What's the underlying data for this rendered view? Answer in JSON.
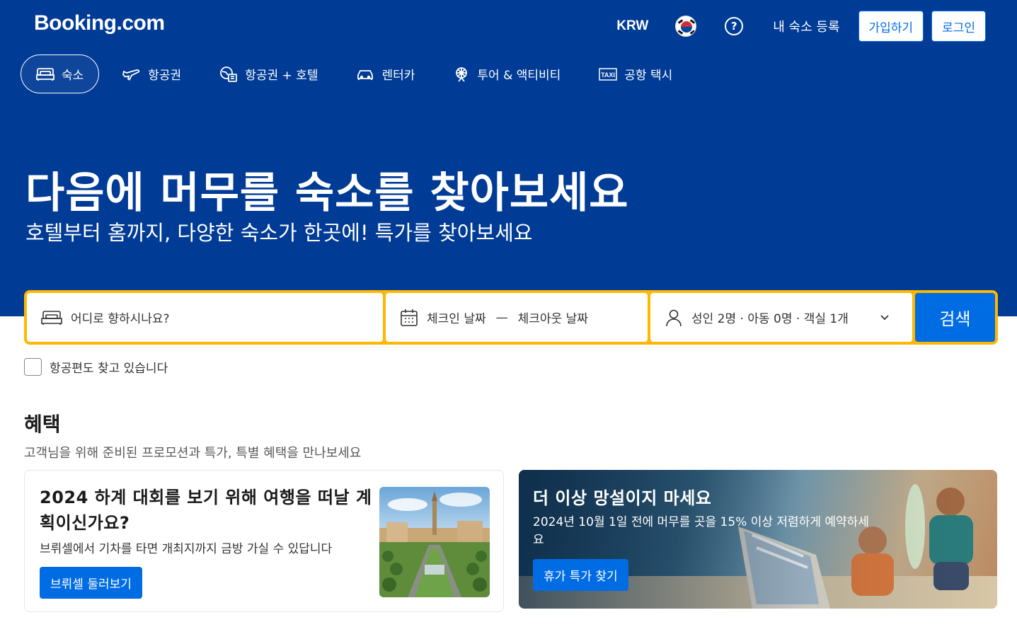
{
  "header": {
    "logo": "Booking.com",
    "currency": "KRW",
    "flag_icon": "south-korea-flag-icon",
    "help_icon": "?",
    "list_property": "내 숙소 등록",
    "register": "가입하기",
    "sign_in": "로그인"
  },
  "nav": {
    "items": [
      {
        "label": "숙소",
        "icon": "bed-icon",
        "active": true
      },
      {
        "label": "항공권",
        "icon": "plane-icon"
      },
      {
        "label": "항공권 + 호텔",
        "icon": "plane-hotel-icon"
      },
      {
        "label": "렌터카",
        "icon": "car-icon"
      },
      {
        "label": "투어 & 액티비티",
        "icon": "attraction-icon"
      },
      {
        "label": "공항 택시",
        "icon": "taxi-icon"
      }
    ]
  },
  "hero": {
    "title": "다음에 머무를 숙소를 찾아보세요",
    "subtitle": "호텔부터 홈까지, 다양한 숙소가 한곳에! 특가를 찾아보세요"
  },
  "search": {
    "destination_placeholder": "어디로 향하시나요?",
    "checkin": "체크인 날짜",
    "date_separator": "—",
    "checkout": "체크아웃 날짜",
    "occupancy": "성인 2명 · 아동 0명 · 객실 1개",
    "button": "검색"
  },
  "flight_checkbox": {
    "label": "항공편도 찾고 있습니다",
    "checked": false
  },
  "offers": {
    "title": "혜택",
    "subtitle": "고객님을 위해 준비된 프로모션과 특가, 특별 혜택을 만나보세요",
    "cards": [
      {
        "title": "2024 하계 대회를 보기 위해 여행을 떠날 계획이신가요?",
        "description": "브뤼셀에서 기차를 타면 개최지까지 금방 가실 수 있답니다",
        "button": "브뤼셀 둘러보기"
      },
      {
        "title": "더 이상 망설이지 마세요",
        "description": "2024년 10월 1일 전에 머무를 곳을 15% 이상 저렴하게 예약하세요",
        "button": "휴가 특가 찾기"
      }
    ]
  },
  "colors": {
    "brand_blue": "#003b95",
    "action_blue": "#006ce4",
    "search_border": "#ffb700"
  }
}
